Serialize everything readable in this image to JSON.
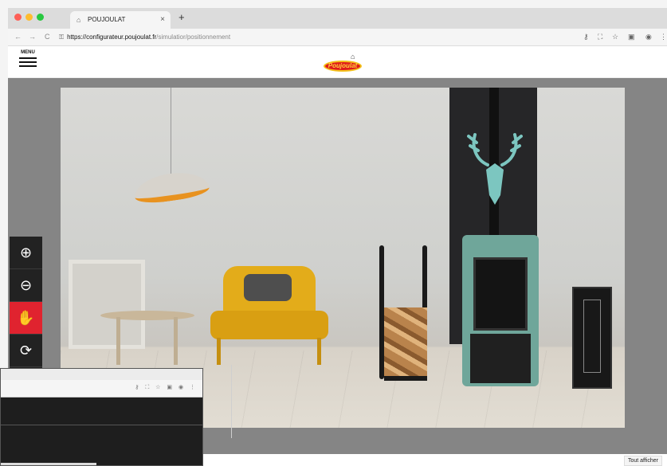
{
  "browser": {
    "tab_title": "POUJOULAT",
    "tab_close": "×",
    "new_tab": "+",
    "url_domain": "https://configurateur.poujoulat.fr",
    "url_path": "/simulatior/positionnement",
    "back": "←",
    "forward": "→",
    "reload": "C",
    "lock": "🔒"
  },
  "header": {
    "menu_label": "MENU",
    "logo_text": "Poujoulat"
  },
  "toolbar": {
    "buttons": [
      {
        "name": "zoom-in",
        "glyph": "⊕"
      },
      {
        "name": "zoom-out",
        "glyph": "⊖"
      },
      {
        "name": "pan",
        "glyph": "✋"
      },
      {
        "name": "swap",
        "glyph": "⟳"
      },
      {
        "name": "save",
        "glyph": "💾"
      }
    ],
    "active_index": 2,
    "active_color": "#e0232f"
  },
  "footer": {
    "show_all": "Tout afficher"
  },
  "colors": {
    "stove": "#6fa69a",
    "chair": "#e3ac1a",
    "lamp_inner": "#e8921f"
  }
}
